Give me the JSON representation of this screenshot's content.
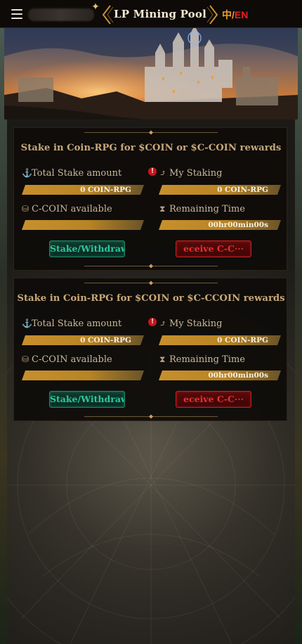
{
  "header": {
    "title": "LP Mining Pool",
    "lang_zh": "中",
    "lang_sep": "/",
    "lang_en": "EN"
  },
  "pools": [
    {
      "title": "Stake in Coin-RPG for $COIN or $C-COIN rewards",
      "total_stake_label": "Total Stake amount",
      "total_stake_value": "0 COIN-RPG",
      "my_staking_label": "My Staking",
      "my_staking_value": "0 COIN-RPG",
      "ccoin_label": "C-COIN available",
      "remaining_label": "Remaining Time",
      "remaining_value": "00hr00min00s",
      "stake_button": "Stake/Withdraw",
      "receive_button": "eceive C-C···"
    },
    {
      "title": "Stake in Coin-RPG for $COIN or $C-CCOIN rewards",
      "total_stake_label": "Total Stake amount",
      "total_stake_value": "0 COIN-RPG",
      "my_staking_label": "My Staking",
      "my_staking_value": "0 COIN-RPG",
      "ccoin_label": "C-COIN available",
      "remaining_label": "Remaining Time",
      "remaining_value": "00hr00min00s",
      "stake_button": "Stake/Withdraw",
      "receive_button": "eceive C-C···"
    }
  ],
  "icons": {
    "menu": "hamburger-icon",
    "total_stake": "anchor-icon",
    "my_staking": "chart-up-icon",
    "ccoin": "coin-stack-icon",
    "remaining": "hourglass-icon",
    "warning": "warning-badge-icon"
  },
  "colors": {
    "accent_gold": "#c8902c",
    "stake_green": "#2ec89a",
    "receive_red": "#e83030",
    "lang_en_red": "#e82020"
  }
}
